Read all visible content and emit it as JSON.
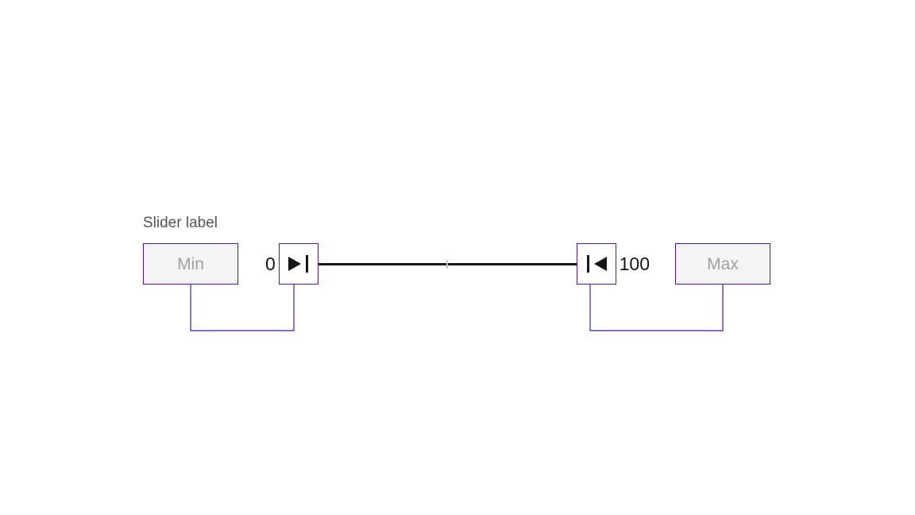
{
  "slider": {
    "label": "Slider label",
    "min_placeholder": "Min",
    "max_placeholder": "Max",
    "range_min": "0",
    "range_max": "100"
  },
  "colors": {
    "accent": "#4b14b8",
    "text_muted": "#a0a0a0",
    "text": "#161616"
  }
}
